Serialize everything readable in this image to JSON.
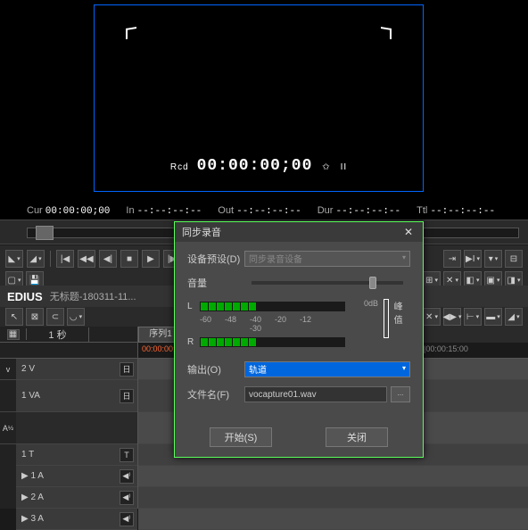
{
  "preview": {
    "rcd_label": "Rcd",
    "timecode": "00:00:00;00",
    "star": "✩",
    "pause": "II"
  },
  "tcbar": {
    "cur_lbl": "Cur",
    "cur_val": "00:00:00;00",
    "in_lbl": "In",
    "in_val": "--:--:--:--",
    "out_lbl": "Out",
    "out_val": "--:--:--:--",
    "dur_lbl": "Dur",
    "dur_val": "--:--:--:--",
    "ttl_lbl": "Ttl",
    "ttl_val": "--:--:--:--"
  },
  "app": {
    "name": "EDIUS",
    "document": "无标题-180311-11..."
  },
  "sequence_tab": "序列1",
  "ruler": {
    "scale_label": "1 秒"
  },
  "ticks": {
    "t0": "00:00:00;00",
    "t1": "|00:00:15:00"
  },
  "gutter": {
    "v": "v",
    "a": "A",
    "frac": "½"
  },
  "tracks": [
    {
      "name": "2 V",
      "icon": "日"
    },
    {
      "name": "1 VA",
      "icon": "日"
    },
    {
      "name": "1 T",
      "icon": "T"
    },
    {
      "name": "▶ 1 A",
      "icon": "◀⁾"
    },
    {
      "name": "▶ 2 A",
      "icon": "◀⁾"
    },
    {
      "name": "▶ 3 A",
      "icon": "◀⁾"
    }
  ],
  "dialog": {
    "title": "同步录音",
    "device_label": "设备预设(D)",
    "device_value": "同步录音设备",
    "volume_label": "音量",
    "channels": {
      "l": "L",
      "r": "R"
    },
    "scale": [
      "-60",
      "-48",
      "-40 -30",
      "-20",
      "-12"
    ],
    "scale_end": "0dB",
    "peak_label": "峰值",
    "output_label": "输出(O)",
    "output_value": "轨道",
    "filename_label": "文件名(F)",
    "filename_value": "vocapture01.wav",
    "browse": "...",
    "start_btn": "开始(S)",
    "close_btn": "关闭"
  }
}
